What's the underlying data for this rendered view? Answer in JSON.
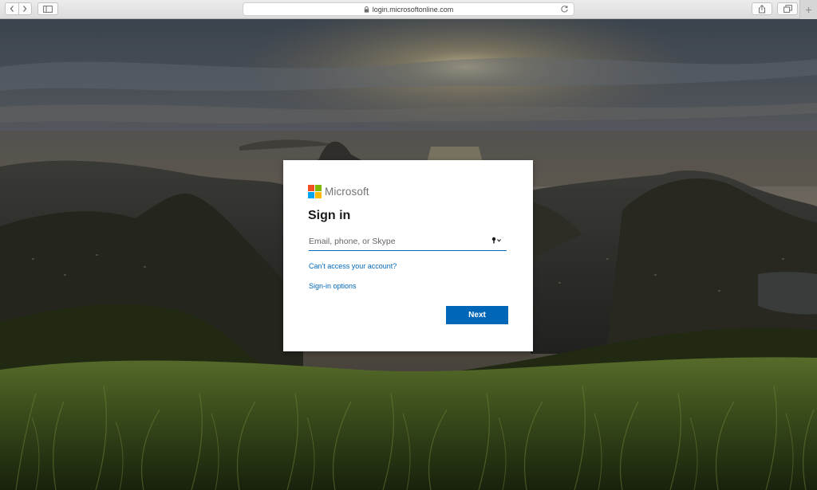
{
  "browser": {
    "url": "login.microsoftonline.com",
    "icons": {
      "back": "chevron-left-icon",
      "forward": "chevron-right-icon",
      "sidebar": "sidebar-icon",
      "lock": "lock-icon",
      "reload": "reload-icon",
      "share": "share-icon",
      "tabs": "tabs-icon",
      "new_tab": "plus-icon"
    },
    "new_tab_symbol": "+"
  },
  "signin": {
    "brand": "Microsoft",
    "title": "Sign in",
    "email_placeholder": "Email, phone, or Skype",
    "email_value": "",
    "cant_access_link": "Can't access your account?",
    "signin_options_link": "Sign-in options",
    "next_label": "Next",
    "logo_colors": [
      "#f25022",
      "#7fba00",
      "#00a4ef",
      "#ffb900"
    ],
    "accent_color": "#0067b8"
  }
}
